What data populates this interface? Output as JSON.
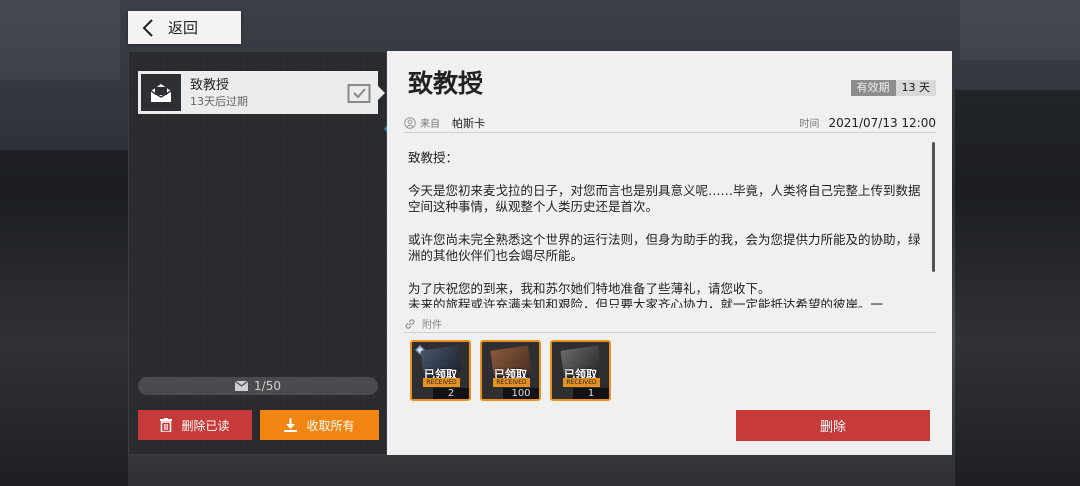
{
  "nav": {
    "back_label": "返回"
  },
  "mail_list": {
    "items": [
      {
        "title": "致教授",
        "expiry": "13天后过期"
      }
    ],
    "count": "1/50",
    "delete_read_label": "删除已读",
    "collect_all_label": "收取所有"
  },
  "mail": {
    "title": "致教授",
    "expiry_key": "有效期",
    "expiry_value": "13 天",
    "from_label": "来自",
    "from_name": "帕斯卡",
    "time_label": "时间",
    "time_value": "2021/07/13 12:00",
    "body": {
      "greeting": "致教授：",
      "p1": "今天是您初来麦戈拉的日子，对您而言也是别具意义呢……毕竟，人类将自己完整上传到数据空间这种事情，纵观整个人类历史还是首次。",
      "p2": "或许您尚未完全熟悉这个世界的运行法则，但身为助手的我，会为您提供力所能及的协助，绿洲的其他伙伴们也会竭尽所能。",
      "p3": "为了庆祝您的到来，我和苏尔她们特地准备了些薄礼，请您收下。",
      "p4": "未来的旅程或许充满未知和艰险，但只要大家齐心协力，就一定能抵达希望的彼岸。一"
    },
    "attachments_label": "附件",
    "attachments": [
      {
        "status_cn": "已领取",
        "status_en": "RECEIVED",
        "qty": "2"
      },
      {
        "status_cn": "已领取",
        "status_en": "RECEIVED",
        "qty": "100"
      },
      {
        "status_cn": "已领取",
        "status_en": "RECEIVED",
        "qty": "1"
      }
    ],
    "delete_label": "删除"
  },
  "colors": {
    "accent_red": "#c63a39",
    "accent_orange": "#f28412",
    "item_border": "#e7921e"
  }
}
